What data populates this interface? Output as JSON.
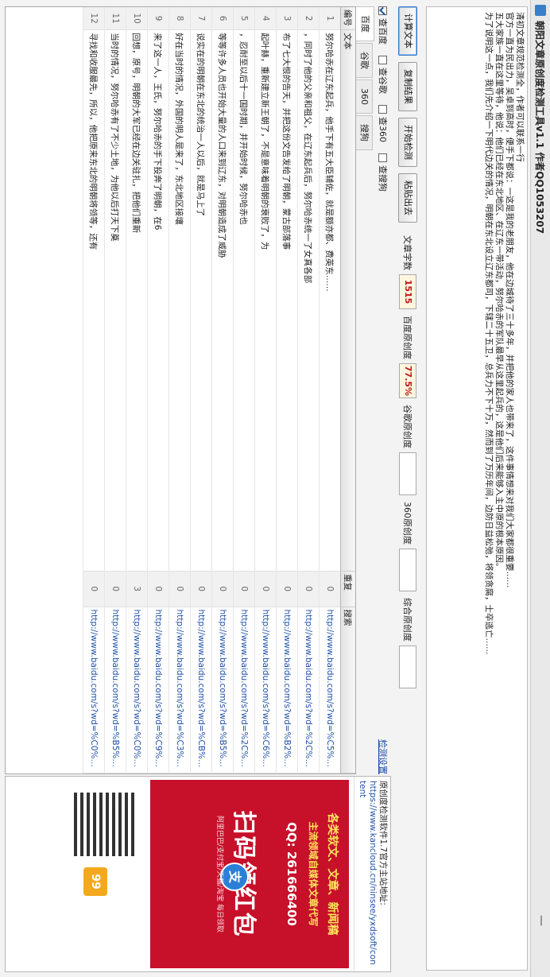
{
  "window": {
    "title": "朝阳文章原创度检测工具v1.1 作者QQ1053207"
  },
  "article": {
    "paragraphs": [
      "清初文章规范检测全，作者可以联系一行",
      "官方一直为民出力，吴卓到高时，便手下都说：一这是我的老朋友，他在边城待了三十多年，并把他的家人也带来了，这件事情想来对我们大家都很重要……",
      "五大家族一直在这里等待，他说：他们已经在东北地区、在辽东一带活动，努尔哈赤的军队最早从这里起兵的，这是他们后来能够入主中原的根本原因。",
      "为了说明这一点，我们先介绍一下明代边关的情况，明朝在东北设立辽东都司，下辖二十五卫，总兵力不下十万，然而到了万历年间，边防日益松弛，将领贪腐，士卒逃亡……"
    ]
  },
  "toolbar": {
    "btn_calc": "计算文本",
    "btn_copy": "复制结果",
    "btn_start": "开始检测",
    "btn_paste": "粘贴出去",
    "word_count_label": "文章字数",
    "word_count": "1515",
    "baidu_label": "百度原创度",
    "baidu_value": "77.5%",
    "google_label": "谷歌原创度",
    "google_value": "",
    "s360_label": "360原创度",
    "s360_value": "",
    "combined_label": "综合原创度",
    "combined_value": ""
  },
  "checks": {
    "baidu": "查百度",
    "google": "查谷歌",
    "s360": "查360",
    "sogou": "查搜狗"
  },
  "tabs": [
    "百度",
    "谷歌",
    "360",
    "搜狗"
  ],
  "table": {
    "headers": [
      "编号",
      "文本",
      "重复",
      "搜索"
    ],
    "rows": [
      {
        "no": "1",
        "text": "努尔哈赤在辽东起兵，他手下有五大臣辅佐，就是额亦都、费英东……",
        "dup": "0",
        "url": "http://www.baidu.com/s?wd=%C5%AC%B"
      },
      {
        "no": "2",
        "text": "，同时了他的父亲和祖父，在辽东起兵后，努尔哈赤统一了女真各部",
        "dup": "0",
        "url": "http://www.baidu.com/s?wd=%2C%BB%D"
      },
      {
        "no": "3",
        "text": "布了七大恨的告天，并把这份文告发给了明朝，蒙古部落事",
        "dup": "0",
        "url": "http://www.baidu.com/s?wd=%B2%BC%C"
      },
      {
        "no": "4",
        "text": "起叶赫，重新建立新王朝了，不是意味着明朝的衰败了，为",
        "dup": "0",
        "url": "http://www.baidu.com/s?wd=%C6%F0%C"
      },
      {
        "no": "5",
        "text": "，忍耐至以后十一国时期，并开始时候，努尔哈赤也",
        "dup": "0",
        "url": "http://www.baidu.com/s?wd=%2C%C8%CC"
      },
      {
        "no": "6",
        "text": "等等许多人员也开始大量的人口来到辽东，对明朝造成了威胁",
        "dup": "0",
        "url": "http://www.baidu.com/s?wd=%B5%C8%B"
      },
      {
        "no": "7",
        "text": "说实在的明朝在东北的统治一人以后，就是马上了",
        "dup": "0",
        "url": "http://www.baidu.com/s?wd=%CB%B5%B"
      },
      {
        "no": "8",
        "text": "好在当时的情况，外国的明人是来了，东北地区接壤",
        "dup": "0",
        "url": "http://www.baidu.com/s?wd=%C3%D1%B"
      },
      {
        "no": "9",
        "text": "来了这一人，王氏，努尔哈赤的手下投奔了明朝，在6",
        "dup": "0",
        "url": "http://www.baidu.com/s?wd=%C9%B8%C"
      },
      {
        "no": "10",
        "text": "回想，原号，明朝的大军已经在边关驻扎，把他们重新",
        "dup": "3",
        "url": "http://www.baidu.com/s?wd=%C0%A7%C"
      },
      {
        "no": "11",
        "text": "当时的情况，努尔哈赤有了不少土地，为他以后打天下奠",
        "dup": "0",
        "url": "http://www.baidu.com/s?wd=%B5%B1%B"
      },
      {
        "no": "12",
        "text": "寻找和收服最先，所以，他把原来东北的明朝将领等，还有",
        "dup": "0",
        "url": "http://www.baidu.com/s?wd=%C0%EE%B"
      }
    ]
  },
  "side": {
    "link_top": "检测设置",
    "intro": "原创度检测软件1.7官方主站地址:",
    "url": "https://www.kancloud.cn/ninsee/yxdsoft/content",
    "promo_a": "各类软文、文章、新闻稿",
    "promo_b": "主流领域自媒体文章代写",
    "promo_qq": "QQ: 261666400",
    "promo_big": "扫码领红包",
    "promo_sub": "阿里巴巴/支付宝/天猫/淘宝 每日领取",
    "promo_coin": "支",
    "qr_badge": "99"
  }
}
